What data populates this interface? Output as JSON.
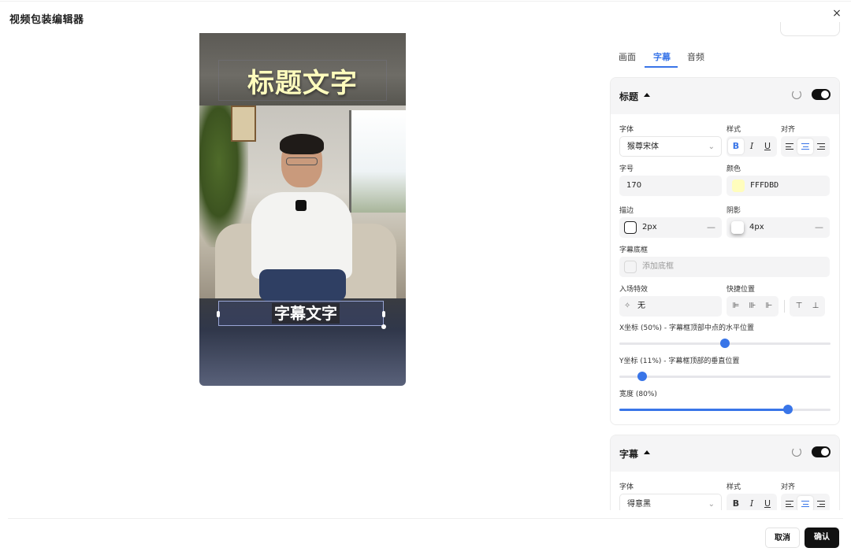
{
  "dialog": {
    "title": "视频包装编辑器",
    "close": "×"
  },
  "preview": {
    "title_text": "标题文字",
    "subtitle_text": "字幕文字",
    "title_color": "#FFFDBD"
  },
  "tabs": [
    {
      "label": "画面",
      "active": false
    },
    {
      "label": "字幕",
      "active": true
    },
    {
      "label": "音频",
      "active": false
    }
  ],
  "title_card": {
    "heading": "标题",
    "enabled": true,
    "font_label": "字体",
    "font_value": "猴尊宋体",
    "style_label": "样式",
    "style_bold": "B",
    "style_italic": "I",
    "style_underline": "U",
    "align_label": "对齐",
    "size_label": "字号",
    "size_value": "170",
    "color_label": "颜色",
    "color_value": "FFFDBD",
    "color_hex": "#FFFDBD",
    "stroke_label": "描边",
    "stroke_value": "2px",
    "shadow_label": "阴影",
    "shadow_value": "4px",
    "box_label": "字幕底框",
    "box_placeholder": "添加底框",
    "effect_label": "入场特效",
    "effect_value": "无",
    "quickpos_label": "快捷位置",
    "x_label": "X坐标 (50%) - 字幕框顶部中点的水平位置",
    "x_value": 0.5,
    "y_label": "Y坐标 (11%) - 字幕框顶部的垂直位置",
    "y_value": 0.11,
    "width_label": "宽度 (80%)",
    "width_value": 0.8
  },
  "subtitle_card": {
    "heading": "字幕",
    "enabled": true,
    "font_label": "字体",
    "font_value": "得意黑",
    "style_label": "样式",
    "style_bold": "B",
    "style_italic": "I",
    "style_underline": "U",
    "align_label": "对齐"
  },
  "footer": {
    "cancel": "取消",
    "confirm": "确认"
  },
  "colors": {
    "accent": "#3975e8",
    "dark": "#111111"
  }
}
